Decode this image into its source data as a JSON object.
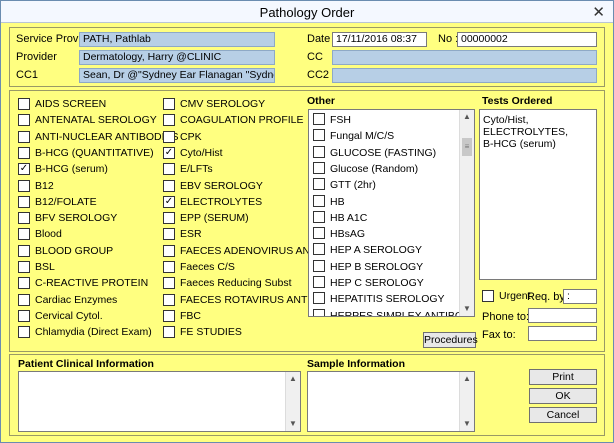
{
  "window": {
    "title": "Pathology Order",
    "close_glyph": "✕"
  },
  "header": {
    "service_provider_label": "Service Provider",
    "service_provider_value": "PATH, Pathlab",
    "provider_label": "Provider",
    "provider_value": "Dermatology, Harry @CLINIC",
    "cc1_label": "CC1",
    "cc1_value": "Sean, Dr @\"Sydney Ear Flanagan \"Sydney Ear:sydentcl/(",
    "date_label": "Date",
    "date_value": "17/11/2016 08:37",
    "no_label": "No :",
    "no_value": "00000002",
    "cc_label": "CC",
    "cc_value": "",
    "cc2_label": "CC2",
    "cc2_value": ""
  },
  "tests": {
    "col1": [
      {
        "label": "AIDS SCREEN",
        "checked": false
      },
      {
        "label": "ANTENATAL SEROLOGY",
        "checked": false
      },
      {
        "label": "ANTI-NUCLEAR ANTIBODIES",
        "checked": false
      },
      {
        "label": "B-HCG (QUANTITATIVE)",
        "checked": false
      },
      {
        "label": "B-HCG (serum)",
        "checked": true
      },
      {
        "label": "B12",
        "checked": false
      },
      {
        "label": "B12/FOLATE",
        "checked": false
      },
      {
        "label": "BFV SEROLOGY",
        "checked": false
      },
      {
        "label": "Blood",
        "checked": false
      },
      {
        "label": "BLOOD GROUP",
        "checked": false
      },
      {
        "label": "BSL",
        "checked": false
      },
      {
        "label": "C-REACTIVE PROTEIN",
        "checked": false
      },
      {
        "label": "Cardiac Enzymes",
        "checked": false
      },
      {
        "label": "Cervical Cytol.",
        "checked": false
      },
      {
        "label": "Chlamydia (Direct Exam)",
        "checked": false
      }
    ],
    "col2": [
      {
        "label": "CMV SEROLOGY",
        "checked": false
      },
      {
        "label": "COAGULATION PROFILE",
        "checked": false
      },
      {
        "label": "CPK",
        "checked": false
      },
      {
        "label": "Cyto/Hist",
        "checked": true
      },
      {
        "label": "E/LFTs",
        "checked": false
      },
      {
        "label": "EBV SEROLOGY",
        "checked": false
      },
      {
        "label": "ELECTROLYTES",
        "checked": true
      },
      {
        "label": "EPP (SERUM)",
        "checked": false
      },
      {
        "label": "ESR",
        "checked": false
      },
      {
        "label": "FAECES ADENOVIRUS ANTIGEN",
        "checked": false
      },
      {
        "label": "Faeces C/S",
        "checked": false
      },
      {
        "label": "Faeces Reducing Subst",
        "checked": false
      },
      {
        "label": "FAECES ROTAVIRUS ANTIGEN",
        "checked": false
      },
      {
        "label": "FBC",
        "checked": false
      },
      {
        "label": "FE STUDIES",
        "checked": false
      }
    ],
    "check_glyph": "✓"
  },
  "other": {
    "heading": "Other",
    "items": [
      "FSH",
      "Fungal M/C/S",
      "GLUCOSE (FASTING)",
      "Glucose (Random)",
      "GTT (2hr)",
      "HB",
      "HB A1C",
      "HBsAG",
      "HEP A SEROLOGY",
      "HEP B SEROLOGY",
      "HEP C SEROLOGY",
      "HEPATITIS SEROLOGY",
      "HERPES SIMPLEX ANTIBODY"
    ],
    "procedures_label": "Procedures"
  },
  "tests_ordered": {
    "heading": "Tests Ordered",
    "lines": [
      "Cyto/Hist,",
      "ELECTROLYTES,",
      "B-HCG (serum)"
    ],
    "urgent_label": "Urgent",
    "req_by_label": "Req. by",
    "req_by_value": ":",
    "phone_label": "Phone to:",
    "fax_label": "Fax to:"
  },
  "bottom": {
    "clinical_heading": "Patient Clinical Information",
    "sample_heading": "Sample Information",
    "print_label": "Print",
    "ok_label": "OK",
    "cancel_label": "Cancel"
  },
  "scroll": {
    "up": "▲",
    "down": "▼",
    "grip": "≡"
  }
}
